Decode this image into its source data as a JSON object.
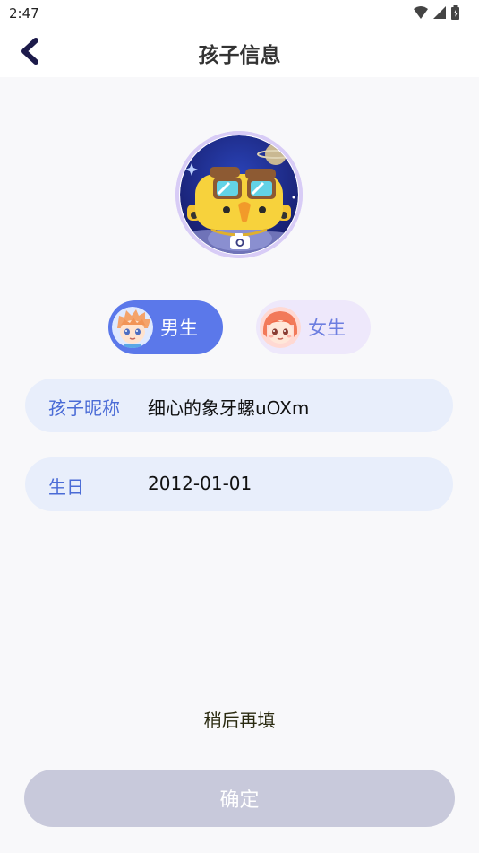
{
  "status_bar": {
    "time": "2:47",
    "icons": [
      "wifi-icon",
      "signal-icon",
      "battery-icon"
    ]
  },
  "header": {
    "title": "孩子信息",
    "back_icon": "chevron-left-icon"
  },
  "avatar": {
    "icon": "camera-icon"
  },
  "gender": {
    "male_label": "男生",
    "female_label": "女生",
    "selected": "male"
  },
  "fields": {
    "nickname_label": "孩子昵称",
    "nickname_value": "细心的象牙螺uOXm",
    "birthday_label": "生日",
    "birthday_value": "2012-01-01"
  },
  "actions": {
    "later": "稍后再填",
    "confirm": "确定"
  },
  "colors": {
    "accent": "#5b78ea",
    "field_bg": "#e8eefb",
    "confirm_disabled": "#c8c9db"
  }
}
